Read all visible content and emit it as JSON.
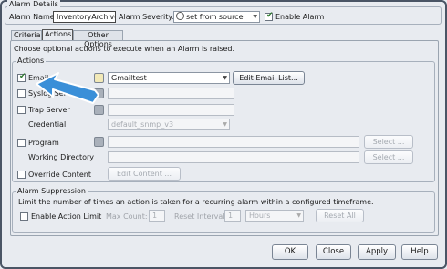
{
  "header": {
    "group_title": "Alarm Details",
    "alarm_name_label": "Alarm Name:",
    "alarm_name_value": "InventoryArchiveI",
    "severity_label": "Alarm Severity:",
    "severity_value": "set from source",
    "enable_alarm_label": "Enable Alarm",
    "enable_alarm_checked": true
  },
  "tabs": [
    {
      "label": "Criteria",
      "active": false
    },
    {
      "label": "Actions",
      "active": true
    },
    {
      "label": "Other Options",
      "active": false
    }
  ],
  "description": "Choose optional actions to execute when an Alarm is raised.",
  "actions": {
    "title": "Actions",
    "email_label": "Email",
    "email_checked": true,
    "email_value": "Gmailtest",
    "edit_email_list": "Edit Email List...",
    "syslog_label": "Syslog Server",
    "syslog_checked": false,
    "trap_label": "Trap Server",
    "trap_checked": false,
    "credential_label": "Credential",
    "credential_value": "default_snmp_v3",
    "program_label": "Program",
    "program_checked": false,
    "program_select": "Select ...",
    "working_dir_label": "Working Directory",
    "working_dir_select": "Select ...",
    "override_label": "Override Content",
    "override_checked": false,
    "edit_content": "Edit Content ..."
  },
  "suppression": {
    "title": "Alarm Suppression",
    "description": "Limit the number of times an action is taken for a recurring alarm within a configured timeframe.",
    "enable_limit_label": "Enable Action Limit",
    "enable_limit_checked": false,
    "max_count_label": "Max Count:",
    "max_count_value": "1",
    "reset_interval_label": "Reset Interval:",
    "reset_interval_value": "1",
    "interval_unit": "Hours",
    "reset_all": "Reset All"
  },
  "footer": {
    "ok": "OK",
    "close": "Close",
    "apply": "Apply",
    "help": "Help"
  },
  "overlay": {
    "arrow_color": "#3a8fd8",
    "arrow_icon": "annotation-arrow-icon"
  }
}
